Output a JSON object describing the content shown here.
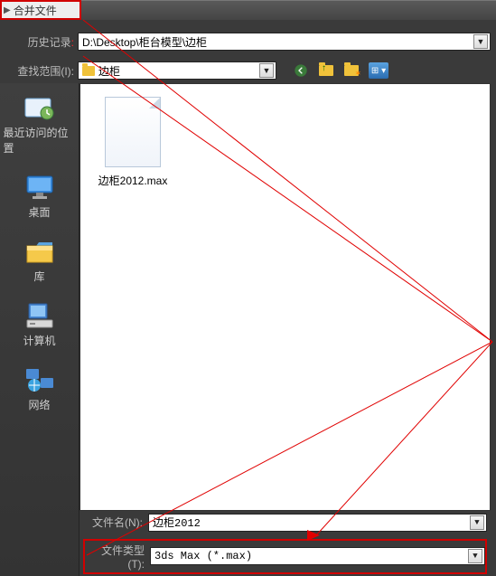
{
  "title": "合并文件",
  "labels": {
    "history": "历史记录",
    "lookin": "查找范围(I)",
    "filename": "文件名(N)",
    "filetype": "文件类型(T)"
  },
  "history_selected": "D:\\Desktop\\柜台模型\\边柜",
  "lookin_selected": "边柜",
  "toolbar_icons": [
    "back",
    "up",
    "new",
    "view"
  ],
  "sidebar": [
    {
      "key": "recent",
      "label": "最近访问的位置"
    },
    {
      "key": "desktop",
      "label": "桌面"
    },
    {
      "key": "library",
      "label": "库"
    },
    {
      "key": "computer",
      "label": "计算机"
    },
    {
      "key": "network",
      "label": "网络"
    }
  ],
  "file_item": {
    "name": "边柜2012.max"
  },
  "filename_value": "边柜2012",
  "filetype_value": "3ds Max (*.max)"
}
